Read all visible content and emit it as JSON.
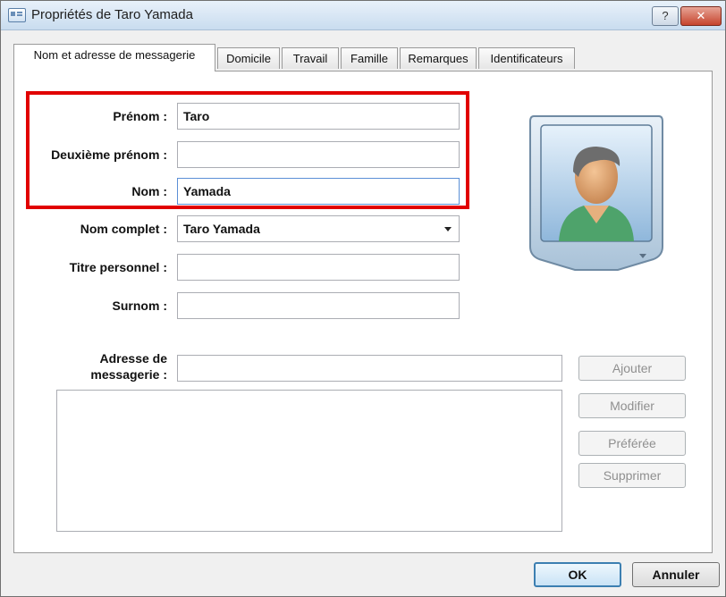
{
  "window": {
    "title": "Propriétés de Taro Yamada",
    "help_glyph": "?",
    "close_glyph": "✕"
  },
  "tabs": [
    {
      "label": "Nom et adresse de messagerie",
      "active": true
    },
    {
      "label": "Domicile",
      "active": false
    },
    {
      "label": "Travail",
      "active": false
    },
    {
      "label": "Famille",
      "active": false
    },
    {
      "label": "Remarques",
      "active": false
    },
    {
      "label": "Identificateurs",
      "active": false
    }
  ],
  "form": {
    "first_name": {
      "label": "Prénom :",
      "value": "Taro"
    },
    "middle_name": {
      "label": "Deuxième prénom :",
      "value": ""
    },
    "last_name": {
      "label": "Nom :",
      "value": "Yamada"
    },
    "full_name": {
      "label": "Nom complet :",
      "value": "Taro Yamada"
    },
    "personal_title": {
      "label": "Titre personnel :",
      "value": ""
    },
    "nickname": {
      "label": "Surnom :",
      "value": ""
    },
    "email": {
      "label_line1": "Adresse de",
      "label_line2": "messagerie :",
      "value": ""
    }
  },
  "email_buttons": {
    "add": "Ajouter",
    "edit": "Modifier",
    "preferred": "Préférée",
    "delete": "Supprimer"
  },
  "dialog_buttons": {
    "ok": "OK",
    "cancel": "Annuler"
  },
  "colors": {
    "highlight": "#e10000",
    "focus_border": "#5b8fd6"
  }
}
